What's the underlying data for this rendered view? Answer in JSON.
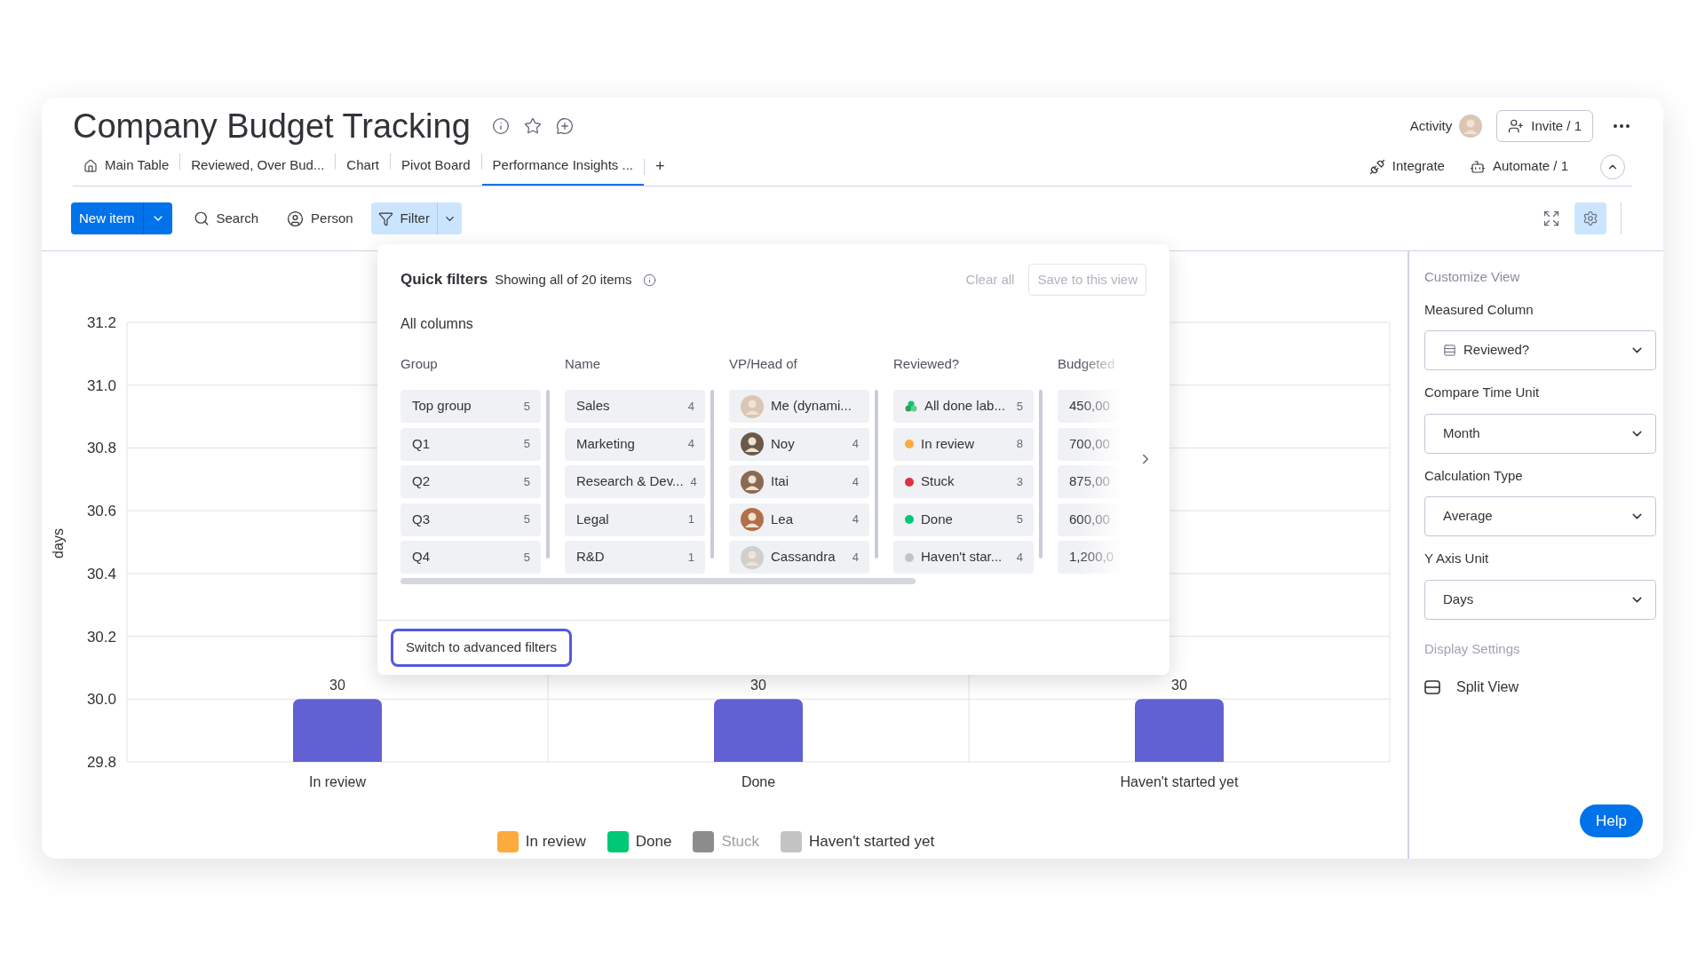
{
  "board": {
    "title": "Company Budget Tracking"
  },
  "header_actions": {
    "activity": "Activity",
    "invite": "Invite / 1"
  },
  "tabs": [
    {
      "label": "Main Table",
      "selected": false,
      "kind": "home"
    },
    {
      "label": "Reviewed, Over Bud...",
      "selected": false,
      "kind": "plain"
    },
    {
      "label": "Chart",
      "selected": false,
      "kind": "plain"
    },
    {
      "label": "Pivot Board",
      "selected": false,
      "kind": "plain"
    },
    {
      "label": "Performance Insights ...",
      "selected": true,
      "kind": "plain"
    }
  ],
  "add_tab": "+",
  "tab_actions": [
    {
      "label": "Integrate",
      "kind": "integrate"
    },
    {
      "label": "Automate / 1",
      "kind": "automate"
    }
  ],
  "toolbar": {
    "new_item": "New item",
    "search": "Search",
    "person": "Person",
    "filter": {
      "label": "Filter",
      "selected": true
    },
    "settings_selected": true
  },
  "quick_filters": {
    "title": "Quick filters",
    "summary": "Showing all of 20 items",
    "clear": "Clear all",
    "save": "Save to this view",
    "section": "All columns",
    "columns": [
      {
        "heading": "Group",
        "items": [
          {
            "kind": "plain",
            "label": "Top group",
            "count": "5"
          },
          {
            "kind": "plain",
            "label": "Q1",
            "count": "5"
          },
          {
            "kind": "plain",
            "label": "Q2",
            "count": "5"
          },
          {
            "kind": "plain",
            "label": "Q3",
            "count": "5"
          },
          {
            "kind": "plain",
            "label": "Q4",
            "count": "5"
          }
        ]
      },
      {
        "heading": "Name",
        "items": [
          {
            "kind": "plain",
            "label": "Sales",
            "count": "4"
          },
          {
            "kind": "plain",
            "label": "Marketing",
            "count": "4"
          },
          {
            "kind": "plain",
            "label": "Research & Dev...",
            "count": "4"
          },
          {
            "kind": "plain",
            "label": "Legal",
            "count": "1"
          },
          {
            "kind": "plain",
            "label": "R&D",
            "count": "1"
          }
        ]
      },
      {
        "heading": "VP/Head of",
        "items": [
          {
            "kind": "person",
            "label": "Me (dynami..."
          },
          {
            "kind": "person",
            "label": "Noy",
            "count": "4"
          },
          {
            "kind": "person",
            "label": "Itai",
            "count": "4"
          },
          {
            "kind": "person",
            "label": "Lea",
            "count": "4"
          },
          {
            "kind": "person",
            "label": "Cassandra",
            "count": "4"
          }
        ]
      },
      {
        "heading": "Reviewed?",
        "items": [
          {
            "kind": "group",
            "label": "All done lab...",
            "count": "5"
          },
          {
            "kind": "status",
            "label": "In review",
            "count": "8",
            "color": "#fdab3d"
          },
          {
            "kind": "status",
            "label": "Stuck",
            "count": "3",
            "color": "#df2f4a"
          },
          {
            "kind": "status",
            "label": "Done",
            "count": "5",
            "color": "#00c875"
          },
          {
            "kind": "status",
            "label": "Haven't star...",
            "count": "4",
            "color": "#c4c4c4"
          }
        ]
      },
      {
        "heading": "Budgeted",
        "items": [
          {
            "kind": "plain",
            "label": "450,00"
          },
          {
            "kind": "plain",
            "label": "700,00"
          },
          {
            "kind": "plain",
            "label": "875,00"
          },
          {
            "kind": "plain",
            "label": "600,00"
          },
          {
            "kind": "plain",
            "label": "1,200,0"
          }
        ]
      }
    ],
    "advanced": "Switch to advanced filters"
  },
  "chart": {
    "chart_data": {
      "type": "bar",
      "ylabel": "days",
      "categories": [
        "In review",
        "Done",
        "Haven't started yet"
      ],
      "series": [
        {
          "color": "#6161d3",
          "values": [
            30,
            30,
            30
          ]
        }
      ],
      "ylim": [
        29.8,
        31.2
      ],
      "yticks": [
        29.8,
        {
          "value": 30,
          "label": "30.0"
        },
        30.2,
        30.4,
        30.6,
        30.8,
        {
          "value": 31,
          "label": "31.0"
        },
        31.2
      ],
      "grid": true,
      "data_labels": true
    },
    "legend": [
      {
        "label": "In review",
        "color": "#fdab3d",
        "hidden": false
      },
      {
        "label": "Done",
        "color": "#00c875",
        "hidden": false
      },
      {
        "label": "Stuck",
        "color": "#8d8d8d",
        "hidden": true
      },
      {
        "label": "Haven't started yet",
        "color": "#c4c4c4",
        "hidden": false
      }
    ]
  },
  "settings_panel": {
    "title": "Customize View",
    "fields": [
      {
        "label": "Measured Column",
        "value": "Reviewed?",
        "kind": "column"
      },
      {
        "label": "Compare Time Unit",
        "value": "Month",
        "kind": "plain"
      },
      {
        "label": "Calculation Type",
        "value": "Average",
        "kind": "plain"
      },
      {
        "label": "Y Axis Unit",
        "value": "Days",
        "kind": "plain"
      }
    ],
    "display_title": "Display Settings",
    "split_view": "Split View"
  },
  "help": "Help"
}
